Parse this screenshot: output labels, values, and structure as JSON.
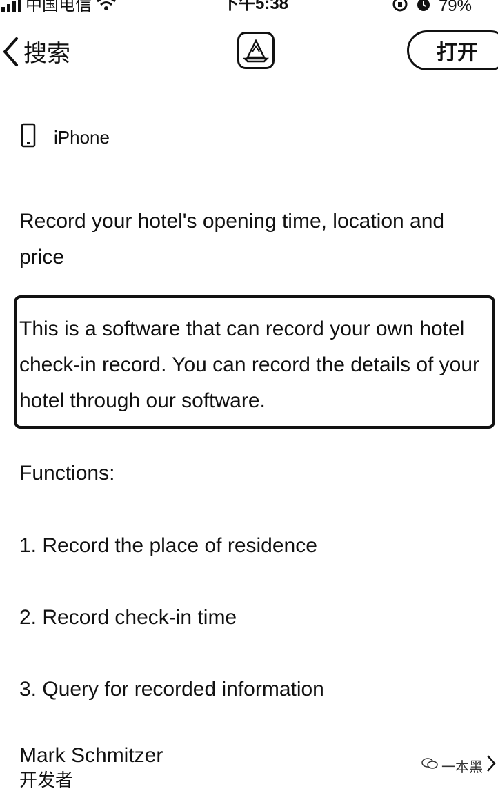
{
  "status_bar": {
    "carrier": "中国电信",
    "time": "下午5:38",
    "battery": "79%"
  },
  "nav": {
    "back_label": "搜索",
    "open_label": "打开"
  },
  "device": {
    "label": "iPhone"
  },
  "subtitle": "Record your hotel's opening time, location and price",
  "description": "This is a software that can record your own hotel check-in record. You can record the details of your hotel through our software.",
  "functions": {
    "heading": "Functions:",
    "items": [
      "1. Record the place of residence",
      "2. Record check-in time",
      "3. Query for recorded information"
    ]
  },
  "developer": {
    "name": "Mark Schmitzer",
    "role": "开发者"
  },
  "watermark": "一本黑"
}
